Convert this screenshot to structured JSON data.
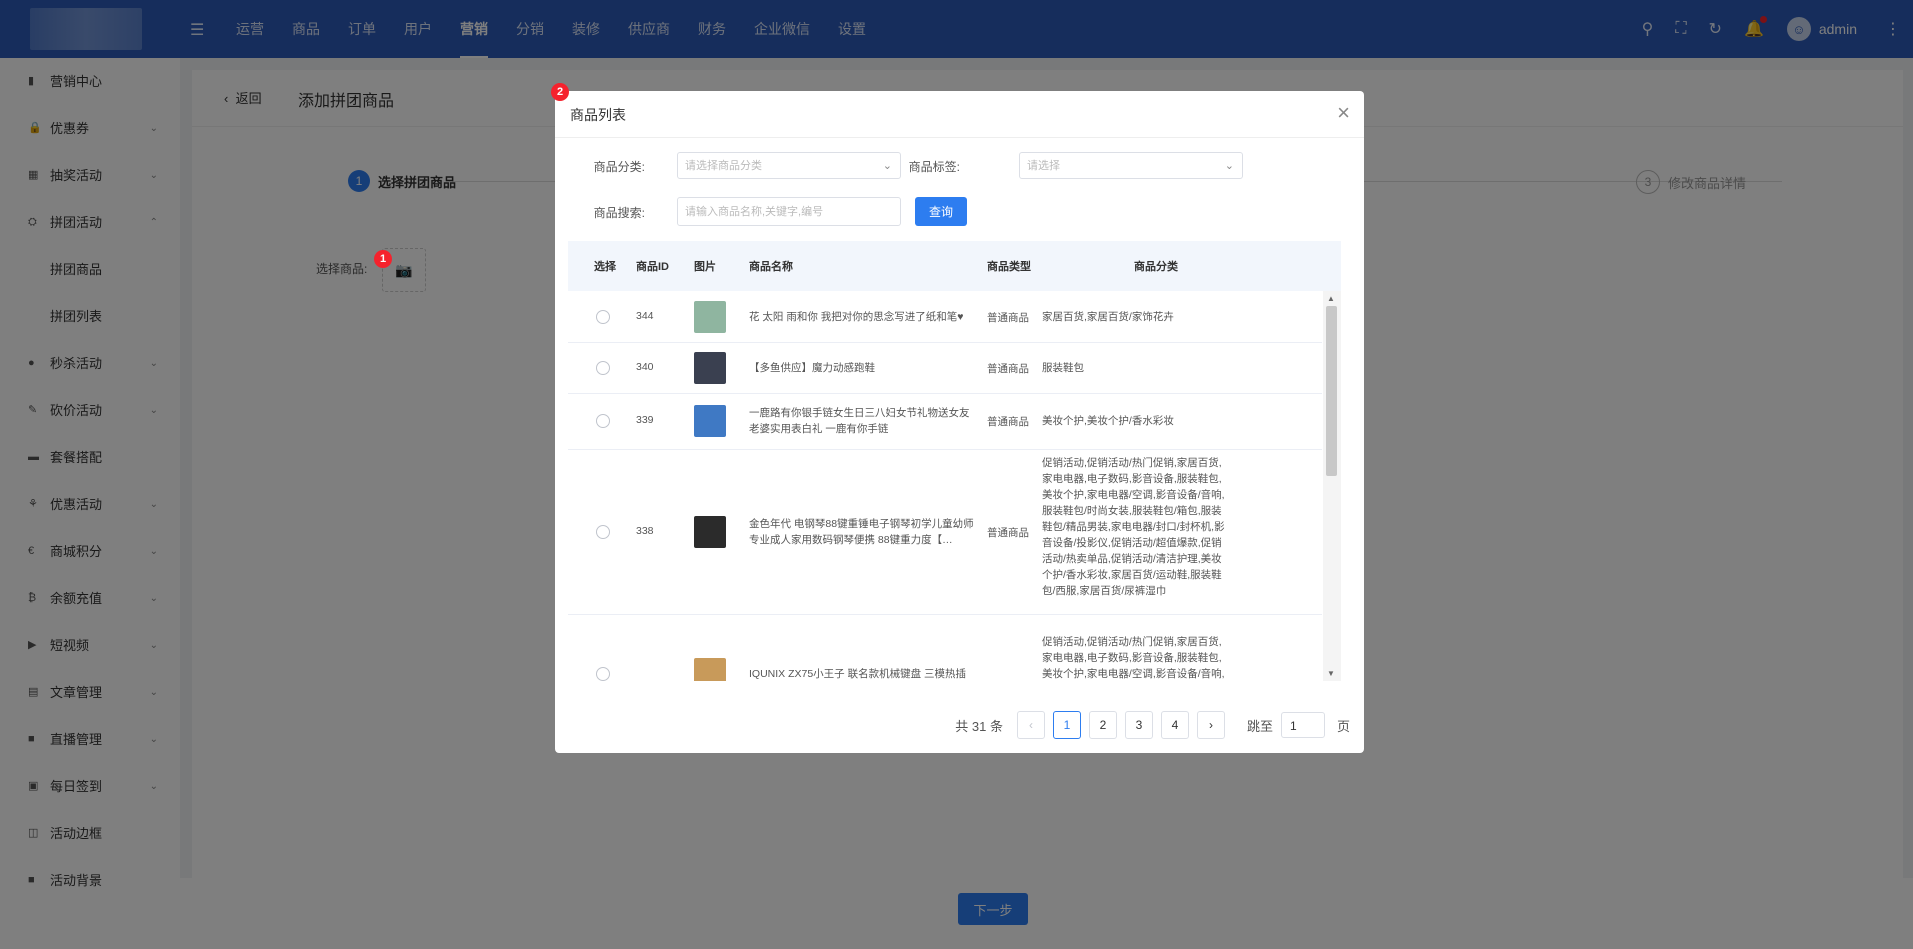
{
  "topbar": {
    "nav": [
      "运营",
      "商品",
      "订单",
      "用户",
      "营销",
      "分销",
      "装修",
      "供应商",
      "财务",
      "企业微信",
      "设置"
    ],
    "active_nav": "营销",
    "user": "admin",
    "icons": [
      "search-icon",
      "fullscreen-icon",
      "refresh-icon",
      "bell-icon"
    ]
  },
  "sidebar": {
    "items": [
      {
        "label": "营销中心",
        "icon": "▮",
        "arrow": ""
      },
      {
        "label": "优惠券",
        "icon": "🔒",
        "arrow": "⌄"
      },
      {
        "label": "抽奖活动",
        "icon": "▦",
        "arrow": "⌄"
      },
      {
        "label": "拼团活动",
        "icon": "⛭",
        "arrow": "⌃"
      },
      {
        "label": "秒杀活动",
        "icon": "●",
        "arrow": "⌄"
      },
      {
        "label": "砍价活动",
        "icon": "✎",
        "arrow": "⌄"
      },
      {
        "label": "套餐搭配",
        "icon": "▬",
        "arrow": ""
      },
      {
        "label": "优惠活动",
        "icon": "⚘",
        "arrow": "⌄"
      },
      {
        "label": "商城积分",
        "icon": "€",
        "arrow": "⌄"
      },
      {
        "label": "余额充值",
        "icon": "₿",
        "arrow": "⌄"
      },
      {
        "label": "短视频",
        "icon": "▶",
        "arrow": "⌄"
      },
      {
        "label": "文章管理",
        "icon": "▤",
        "arrow": "⌄"
      },
      {
        "label": "直播管理",
        "icon": "■",
        "arrow": "⌄"
      },
      {
        "label": "每日签到",
        "icon": "▣",
        "arrow": "⌄"
      },
      {
        "label": "活动边框",
        "icon": "◫",
        "arrow": ""
      },
      {
        "label": "活动背景",
        "icon": "■",
        "arrow": ""
      }
    ],
    "sub_items": [
      "拼团商品",
      "拼团列表"
    ]
  },
  "page": {
    "back": "返回",
    "title": "添加拼团商品",
    "steps": [
      {
        "num": "1",
        "label": "选择拼团商品"
      },
      {
        "num": "3",
        "label": "修改商品详情"
      }
    ],
    "select_label": "选择商品:",
    "next_button": "下一步",
    "badge1": "1",
    "badge2": "2"
  },
  "modal": {
    "title": "商品列表",
    "close": "×",
    "category_label": "商品分类:",
    "category_placeholder": "请选择商品分类",
    "tag_label": "商品标签:",
    "tag_placeholder": "请选择",
    "search_label": "商品搜索:",
    "search_placeholder": "请输入商品名称,关键字,编号",
    "query_button": "查询",
    "columns": [
      "选择",
      "商品ID",
      "图片",
      "商品名称",
      "商品类型",
      "商品分类"
    ],
    "rows": [
      {
        "id": "344",
        "name": "花 太阳 雨和你 我把对你的思念写进了纸和笔♥",
        "type": "普通商品",
        "category": "家居百货,家居百货/家饰花卉",
        "color": "#8fb5a0"
      },
      {
        "id": "340",
        "name": "【多鱼供应】魔力动感跑鞋",
        "type": "普通商品",
        "category": "服装鞋包",
        "color": "#3a4050"
      },
      {
        "id": "339",
        "name": "一鹿路有你银手链女生日三八妇女节礼物送女友老婆实用表白礼 一鹿有你手链",
        "type": "普通商品",
        "category": "美妆个护,美妆个护/香水彩妆",
        "color": "#3f79c4"
      },
      {
        "id": "338",
        "name": "金色年代 电钢琴88键重锤电子钢琴初学儿童幼师专业成人家用数码钢琴便携 88键重力度【…",
        "type": "普通商品",
        "category": "促销活动,促销活动/热门促销,家居百货,家电电器,电子数码,影音设备,服装鞋包,美妆个护,家电电器/空调,影音设备/音响,服装鞋包/时尚女装,服装鞋包/箱包,服装鞋包/精品男装,家电电器/封口/封杯机,影音设备/投影仪,促销活动/超值爆款,促销活动/热卖单品,促销活动/清洁护理,美妆个护/香水彩妆,家居百货/运动鞋,服装鞋包/西服,家居百货/尿裤湿巾",
        "color": "#2b2b2b"
      },
      {
        "id": "",
        "name": "IQUNIX ZX75小王子 联名款机械键盘 三模热插",
        "type": "",
        "category": "促销活动,促销活动/热门促销,家居百货,家电电器,电子数码,影音设备,服装鞋包,美妆个护,家电电器/空调,影音设备/音响,服装鞋包/时尚女装,服装鞋包/箱包",
        "color": "#c89a5a"
      }
    ],
    "pagination": {
      "total": "共 31 条",
      "pages": [
        "1",
        "2",
        "3",
        "4"
      ],
      "current": "1",
      "prev": "‹",
      "next": "›",
      "jump_label": "跳至",
      "jump_value": "1",
      "unit": "页"
    }
  }
}
